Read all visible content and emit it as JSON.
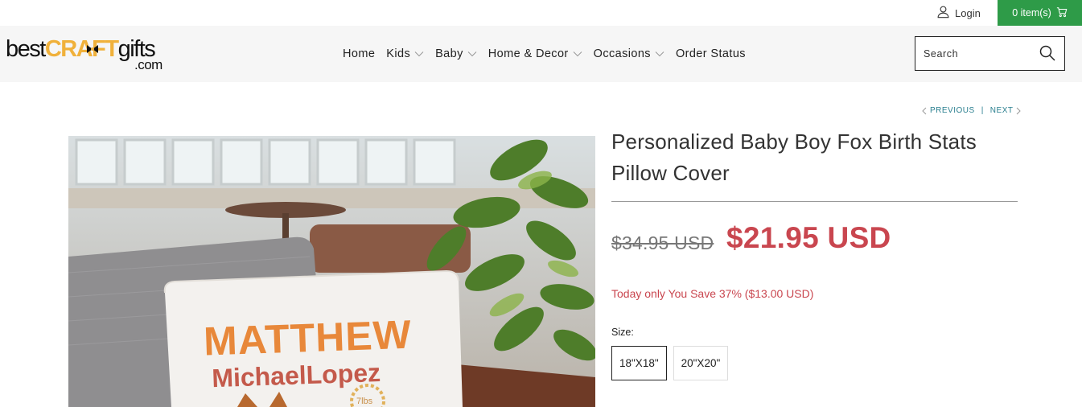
{
  "topbar": {
    "login_label": "Login",
    "cart_label": "0 item(s)",
    "cart_color": "#2e9b48"
  },
  "header": {
    "logo": {
      "part1": "best",
      "part2": "CRAFT",
      "part3": "gifts",
      "part4": ".com"
    },
    "nav": [
      {
        "label": "Home",
        "has_dropdown": false
      },
      {
        "label": "Kids",
        "has_dropdown": true
      },
      {
        "label": "Baby",
        "has_dropdown": true
      },
      {
        "label": "Home & Decor",
        "has_dropdown": true
      },
      {
        "label": "Occasions",
        "has_dropdown": true
      },
      {
        "label": "Order Status",
        "has_dropdown": false
      }
    ],
    "search_placeholder": "Search"
  },
  "pager": {
    "previous": "PREVIOUS",
    "separator": "|",
    "next": "NEXT"
  },
  "product": {
    "title": "Personalized Baby Boy Fox Birth Stats Pillow Cover",
    "compare_price": "$34.95 USD",
    "price": "$21.95 USD",
    "price_color": "#c9464f",
    "savings": "Today only You Save 37% ($13.00 USD)",
    "size_label": "Size:",
    "sizes": [
      {
        "label": "18\"X18\"",
        "selected": true
      },
      {
        "label": "20\"X20\"",
        "selected": false
      }
    ],
    "image": {
      "pillow_name_first": "MATTHEW",
      "pillow_name_rest": "MichaelLopez",
      "pillow_weight": "7lbs"
    }
  }
}
